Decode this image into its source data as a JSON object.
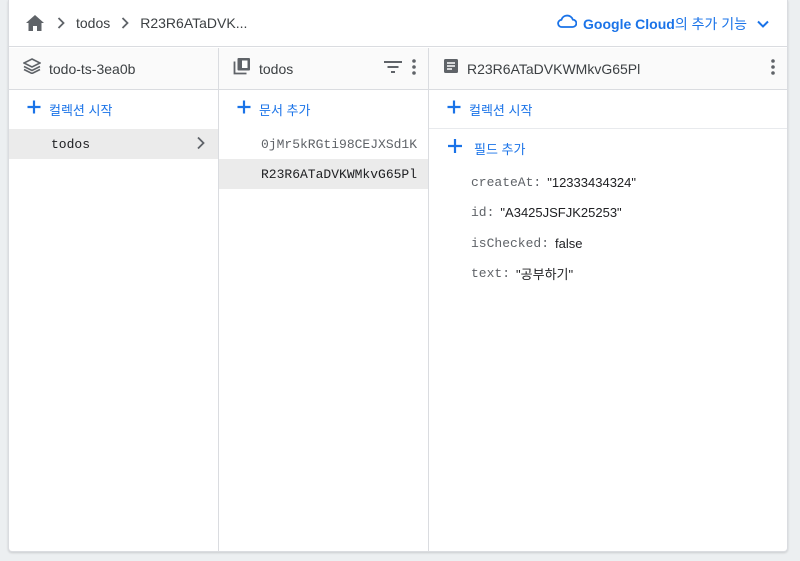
{
  "breadcrumb": {
    "items": [
      "todos",
      "R23R6ATaDVK..."
    ]
  },
  "topbar": {
    "brand": "Google Cloud",
    "suffix": "의 추가 기능"
  },
  "columns": {
    "project": {
      "title": "todo-ts-3ea0b",
      "add_label": "컬렉션 시작",
      "items": [
        "todos"
      ]
    },
    "collection": {
      "title": "todos",
      "add_label": "문서 추가",
      "items": [
        "0jMr5kRGti98CEJXSd1K",
        "R23R6ATaDVKWMkvG65Pl"
      ]
    },
    "document": {
      "title": "R23R6ATaDVKWMkvG65Pl",
      "add_collection_label": "컬렉션 시작",
      "add_field_label": "필드 추가",
      "fields": [
        {
          "key": "createAt",
          "value": "\"12333434324\""
        },
        {
          "key": "id",
          "value": "\"A3425JSFJK25253\""
        },
        {
          "key": "isChecked",
          "value": "false"
        },
        {
          "key": "text",
          "value": "\"공부하기\""
        }
      ]
    }
  },
  "colors": {
    "accent": "#1a73e8",
    "selected_bg": "#ebebeb",
    "border": "#dadce0"
  },
  "icons": [
    "home-icon",
    "chevron-right-icon",
    "cloud-icon",
    "chevron-down-icon",
    "firebase-layers-icon",
    "collection-icon",
    "filter-icon",
    "more-vert-icon",
    "document-icon",
    "plus-icon"
  ]
}
